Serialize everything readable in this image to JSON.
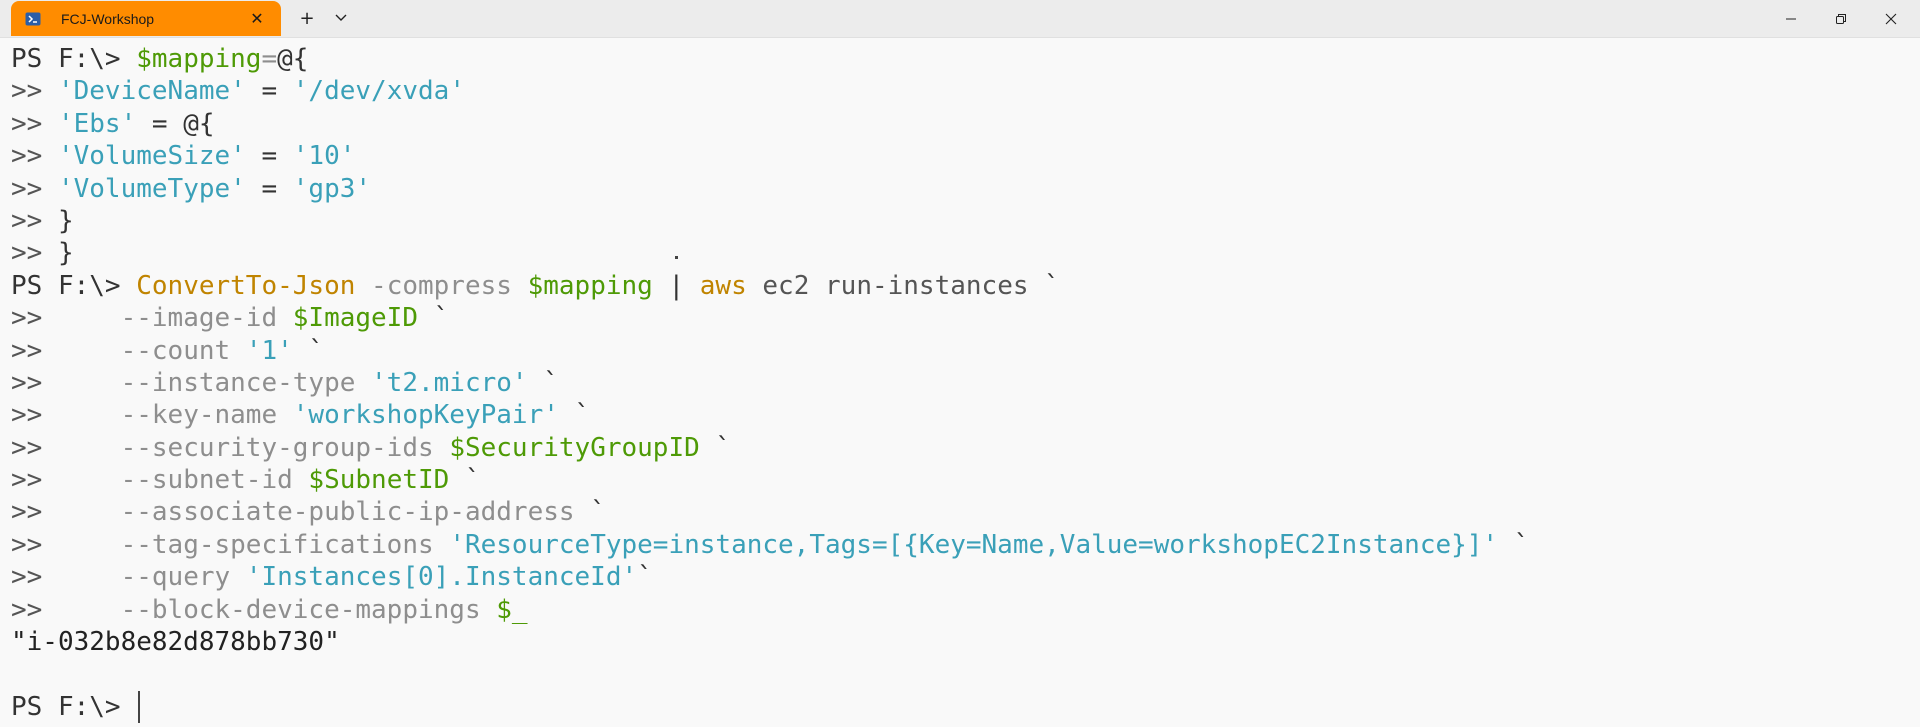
{
  "window": {
    "tab_title": "FCJ-Workshop",
    "tab_close": "✕",
    "new_tab": "+",
    "dropdown": "⌄",
    "accent_color": "#ff8c00"
  },
  "terminal": {
    "lines": [
      [
        {
          "t": "PS F:\\> ",
          "c": "c-prompt"
        },
        {
          "t": "$mapping",
          "c": "c-var"
        },
        {
          "t": "=",
          "c": "c-param"
        },
        {
          "t": "@{",
          "c": "c-op"
        }
      ],
      [
        {
          "t": ">> ",
          "c": "c-cont"
        },
        {
          "t": "'DeviceName'",
          "c": "c-str"
        },
        {
          "t": " = ",
          "c": "c-op"
        },
        {
          "t": "'/dev/xvda'",
          "c": "c-str"
        }
      ],
      [
        {
          "t": ">> ",
          "c": "c-cont"
        },
        {
          "t": "'Ebs'",
          "c": "c-str"
        },
        {
          "t": " = ",
          "c": "c-op"
        },
        {
          "t": "@{",
          "c": "c-op"
        }
      ],
      [
        {
          "t": ">> ",
          "c": "c-cont"
        },
        {
          "t": "'VolumeSize'",
          "c": "c-str"
        },
        {
          "t": " = ",
          "c": "c-op"
        },
        {
          "t": "'10'",
          "c": "c-str"
        }
      ],
      [
        {
          "t": ">> ",
          "c": "c-cont"
        },
        {
          "t": "'VolumeType'",
          "c": "c-str"
        },
        {
          "t": " = ",
          "c": "c-op"
        },
        {
          "t": "'gp3'",
          "c": "c-str"
        }
      ],
      [
        {
          "t": ">> ",
          "c": "c-cont"
        },
        {
          "t": "}",
          "c": "c-op"
        }
      ],
      [
        {
          "t": ">> ",
          "c": "c-cont"
        },
        {
          "t": "}",
          "c": "c-op"
        }
      ],
      [
        {
          "t": "PS F:\\> ",
          "c": "c-prompt"
        },
        {
          "t": "ConvertTo-Json",
          "c": "c-cmd"
        },
        {
          "t": " -compress ",
          "c": "c-param"
        },
        {
          "t": "$mapping",
          "c": "c-var"
        },
        {
          "t": " | ",
          "c": "c-op"
        },
        {
          "t": "aws",
          "c": "c-cmd"
        },
        {
          "t": " ec2 run-instances ",
          "c": "c-arg"
        },
        {
          "t": "`",
          "c": "c-op"
        }
      ],
      [
        {
          "t": ">>     ",
          "c": "c-cont"
        },
        {
          "t": "--image-id ",
          "c": "c-param"
        },
        {
          "t": "$ImageID",
          "c": "c-var"
        },
        {
          "t": " `",
          "c": "c-op"
        }
      ],
      [
        {
          "t": ">>     ",
          "c": "c-cont"
        },
        {
          "t": "--count ",
          "c": "c-param"
        },
        {
          "t": "'1'",
          "c": "c-str"
        },
        {
          "t": " `",
          "c": "c-op"
        }
      ],
      [
        {
          "t": ">>     ",
          "c": "c-cont"
        },
        {
          "t": "--instance-type ",
          "c": "c-param"
        },
        {
          "t": "'t2.micro'",
          "c": "c-str"
        },
        {
          "t": " `",
          "c": "c-op"
        }
      ],
      [
        {
          "t": ">>     ",
          "c": "c-cont"
        },
        {
          "t": "--key-name ",
          "c": "c-param"
        },
        {
          "t": "'workshopKeyPair'",
          "c": "c-str"
        },
        {
          "t": " `",
          "c": "c-op"
        }
      ],
      [
        {
          "t": ">>     ",
          "c": "c-cont"
        },
        {
          "t": "--security-group-ids ",
          "c": "c-param"
        },
        {
          "t": "$SecurityGroupID",
          "c": "c-var"
        },
        {
          "t": " `",
          "c": "c-op"
        }
      ],
      [
        {
          "t": ">>     ",
          "c": "c-cont"
        },
        {
          "t": "--subnet-id ",
          "c": "c-param"
        },
        {
          "t": "$SubnetID",
          "c": "c-var"
        },
        {
          "t": " `",
          "c": "c-op"
        }
      ],
      [
        {
          "t": ">>     ",
          "c": "c-cont"
        },
        {
          "t": "--associate-public-ip-address ",
          "c": "c-param"
        },
        {
          "t": "`",
          "c": "c-op"
        }
      ],
      [
        {
          "t": ">>     ",
          "c": "c-cont"
        },
        {
          "t": "--tag-specifications ",
          "c": "c-param"
        },
        {
          "t": "'ResourceType=instance,Tags=[{Key=Name,Value=workshopEC2Instance}]'",
          "c": "c-str"
        },
        {
          "t": " `",
          "c": "c-op"
        }
      ],
      [
        {
          "t": ">>     ",
          "c": "c-cont"
        },
        {
          "t": "--query ",
          "c": "c-param"
        },
        {
          "t": "'Instances[0].InstanceId'",
          "c": "c-str"
        },
        {
          "t": "`",
          "c": "c-op"
        }
      ],
      [
        {
          "t": ">>     ",
          "c": "c-cont"
        },
        {
          "t": "--block-device-mappings ",
          "c": "c-param"
        },
        {
          "t": "$_",
          "c": "c-var"
        }
      ],
      [
        {
          "t": "\"i-032b8e82d878bb730\"",
          "c": "c-out"
        }
      ],
      [],
      [
        {
          "t": "PS F:\\> ",
          "c": "c-prompt"
        }
      ]
    ]
  }
}
